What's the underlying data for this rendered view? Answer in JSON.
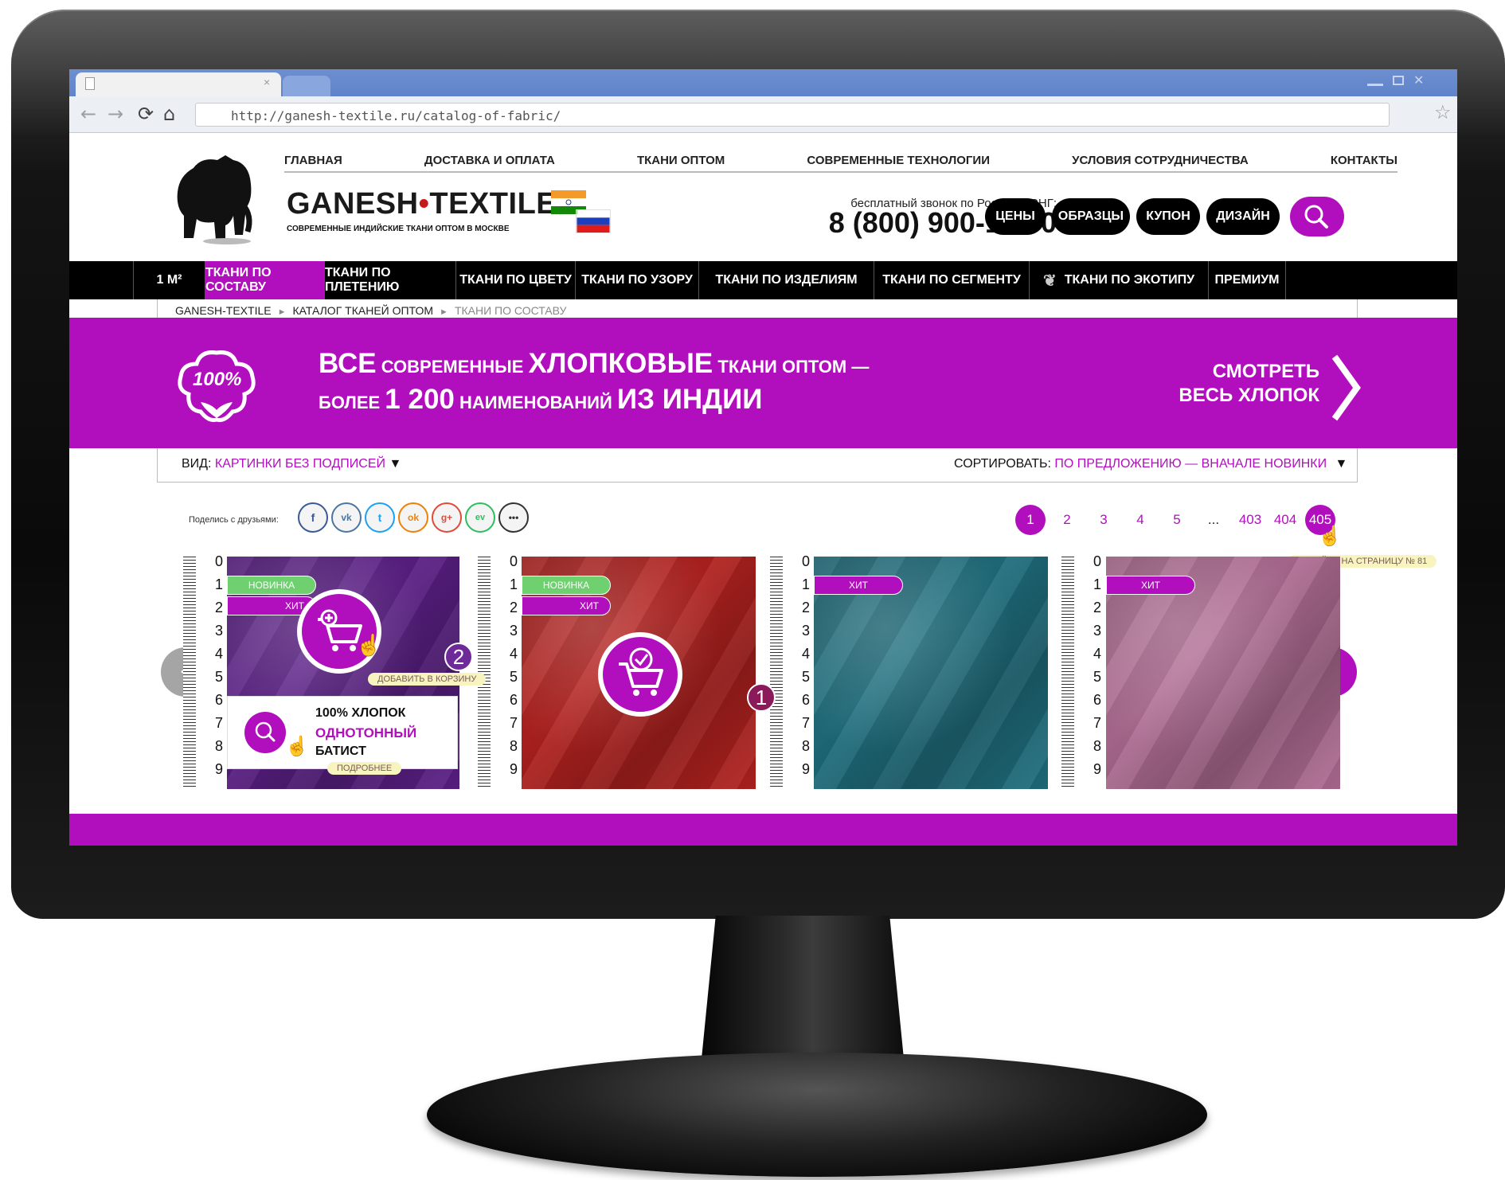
{
  "browser": {
    "url": "http://ganesh-textile.ru/catalog-of-fabric/"
  },
  "header": {
    "brand_left": "GANESH",
    "brand_dot": "•",
    "brand_right": "TEXTILE",
    "tagline": "СОВРЕМЕННЫЕ ИНДИЙСКИЕ ТКАНИ ОПТОМ В МОСКВЕ",
    "top_nav": [
      "ГЛАВНАЯ",
      "ДОСТАВКА И ОПЛАТА",
      "ТКАНИ ОПТОМ",
      "СОВРЕМЕННЫЕ ТЕХНОЛОГИИ",
      "УСЛОВИЯ СОТРУДНИЧЕСТВА",
      "КОНТАКТЫ"
    ],
    "toll_free": "бесплатный звонок по России и СНГ:",
    "phone": "8 (800) 900-11-80",
    "pills": [
      "ЦЕНЫ",
      "ОБРАЗЦЫ",
      "КУПОН",
      "ДИЗАЙН"
    ]
  },
  "catnav": [
    "1 М²",
    "ТКАНИ ПО СОСТАВУ",
    "ТКАНИ ПО ПЛЕТЕНИЮ",
    "ТКАНИ ПО ЦВЕТУ",
    "ТКАНИ ПО УЗОРУ",
    "ТКАНИ ПО ИЗДЕЛИЯМ",
    "ТКАНИ ПО СЕГМЕНТУ",
    "ТКАНИ ПО ЭКОТИПУ",
    "ПРЕМИУМ"
  ],
  "breadcrumbs": [
    "GANESH-TEXTILE",
    "КАТАЛОГ ТКАНЕЙ ОПТОМ",
    "ТКАНИ ПО СОСТАВУ"
  ],
  "banner": {
    "badge": "100%",
    "w1": "ВСЕ",
    "w2": "СОВРЕМЕННЫЕ",
    "w3": "ХЛОПКОВЫЕ",
    "w4": "ТКАНИ ОПТОМ —",
    "w5": "БОЛЕЕ",
    "w6": "1 200",
    "w7": "НАИМЕНОВАНИЙ",
    "w8": "ИЗ ИНДИИ",
    "cta_line1": "СМОТРЕТЬ",
    "cta_line2": "ВЕСЬ ХЛОПОК"
  },
  "sortbar": {
    "view_label": "ВИД:",
    "view_value": "КАРТИНКИ БЕЗ ПОДПИСЕЙ",
    "sort_label": "СОРТИРОВАТЬ:",
    "sort_value": "ПО ПРЕДЛОЖЕНИЮ — ВНАЧАЛЕ НОВИНКИ",
    "caret": "▼"
  },
  "share_label": "Поделись с друзьями:",
  "social": [
    "f",
    "vk",
    "t",
    "ok",
    "g+",
    "ev",
    "•••"
  ],
  "pagination": {
    "pages": [
      "1",
      "2",
      "3",
      "4",
      "5",
      "...",
      "403",
      "404",
      "405"
    ],
    "current": "1",
    "tooltip": "ПЕРЕЙТИ НА СТРАНИЦУ № 81"
  },
  "ruler_numbers": [
    "0",
    "1",
    "2",
    "3",
    "4",
    "5",
    "6",
    "7",
    "8",
    "9"
  ],
  "products": [
    {
      "color": "#5b1f86",
      "badges": [
        "НОВИНКА",
        "ХИТ"
      ],
      "step": "2",
      "tooltip": "ДОБАВИТЬ В КОРЗИНУ",
      "info_line1": "100% ХЛОПОК",
      "info_line2": "ОДНОТОННЫЙ",
      "info_line3": "БАТИСТ",
      "info_link": "ПОДРОБНЕЕ"
    },
    {
      "color": "#b3221f",
      "badges": [
        "НОВИНКА",
        "ХИТ"
      ],
      "step": "1"
    },
    {
      "color": "#1f6f7e",
      "badges": [
        "ХИТ"
      ]
    },
    {
      "color": "#b06d94",
      "badges": [
        "ХИТ"
      ]
    }
  ],
  "carousel": {
    "prev": "<",
    "next": ">"
  },
  "colors": {
    "accent": "#b10fbd",
    "new_badge": "#6ed06e",
    "hit_badge": "#b10fbd"
  }
}
